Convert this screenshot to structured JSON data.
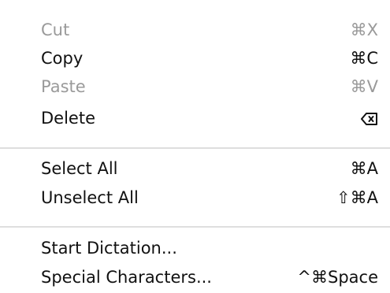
{
  "menu": {
    "items": [
      {
        "label": "Cut",
        "shortcut": "⌘X",
        "enabled": false
      },
      {
        "label": "Copy",
        "shortcut": "⌘C",
        "enabled": true
      },
      {
        "label": "Paste",
        "shortcut": "⌘V",
        "enabled": false
      },
      {
        "label": "Delete",
        "shortcut_icon": "backspace-icon",
        "enabled": true
      },
      {
        "label": "Select All",
        "shortcut": "⌘A",
        "enabled": true
      },
      {
        "label": "Unselect All",
        "shortcut": "⇧⌘A",
        "enabled": true
      },
      {
        "label": "Start Dictation...",
        "shortcut": "",
        "enabled": true
      },
      {
        "label": "Special Characters...",
        "shortcut": "^⌘Space",
        "enabled": true
      }
    ]
  },
  "colors": {
    "enabled_text": "#111111",
    "disabled_text": "#9a9a9a",
    "separator": "#dedede",
    "background": "#ffffff"
  }
}
